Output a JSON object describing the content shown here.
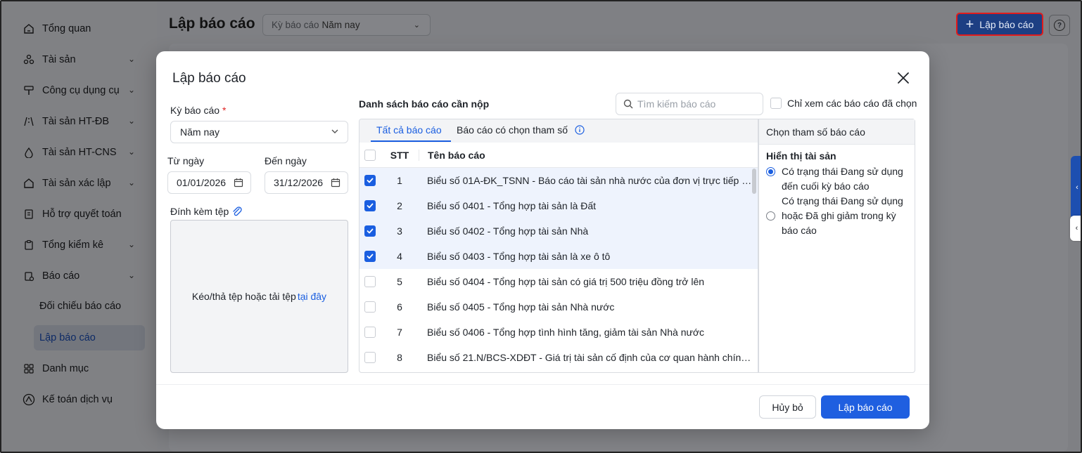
{
  "sidebar": {
    "items": [
      {
        "label": "Tổng quan",
        "icon": "home-icon",
        "has_chevron": false
      },
      {
        "label": "Tài sản",
        "icon": "assets-icon",
        "has_chevron": true
      },
      {
        "label": "Công cụ dụng cụ",
        "icon": "tool-icon",
        "has_chevron": true
      },
      {
        "label": "Tài sản HT-ĐB",
        "icon": "road-icon",
        "has_chevron": true
      },
      {
        "label": "Tài sản HT-CNS",
        "icon": "water-icon",
        "has_chevron": true
      },
      {
        "label": "Tài sản xác lập",
        "icon": "home-outline-icon",
        "has_chevron": true
      },
      {
        "label": "Hỗ trợ quyết toán",
        "icon": "document-icon",
        "has_chevron": false
      },
      {
        "label": "Tổng kiểm kê",
        "icon": "clipboard-icon",
        "has_chevron": true
      },
      {
        "label": "Báo cáo",
        "icon": "report-icon",
        "has_chevron": true
      },
      {
        "label": "Danh mục",
        "icon": "grid-icon",
        "has_chevron": false
      },
      {
        "label": "Kế toán dịch vụ",
        "icon": "service-icon",
        "has_chevron": false
      }
    ],
    "subitems": [
      {
        "label": "Đối chiếu báo cáo",
        "active": false
      },
      {
        "label": "Lập báo cáo",
        "active": true
      }
    ]
  },
  "header": {
    "title": "Lập báo cáo",
    "period_label": "Kỳ báo cáo",
    "period_value": "Năm nay",
    "create_button": "Lập báo cáo"
  },
  "modal": {
    "title": "Lập báo cáo",
    "period_label": "Kỳ báo cáo",
    "required_mark": "*",
    "period_value": "Năm nay",
    "from_label": "Từ ngày",
    "to_label": "Đến ngày",
    "from_date": "01/01/2026",
    "to_date": "31/12/2026",
    "attach_label": "Đính kèm tệp",
    "drop_text": "Kéo/thả tệp hoặc tải tệp",
    "drop_link": "tại đây",
    "list_title": "Danh sách báo cáo cần nộp",
    "search_placeholder": "Tìm kiếm báo cáo",
    "only_selected_label": "Chỉ xem các báo cáo đã chọn",
    "tabs": [
      {
        "label": "Tất cả báo cáo",
        "active": true
      },
      {
        "label": "Báo cáo có chọn tham số",
        "active": false
      }
    ],
    "columns": {
      "stt": "STT",
      "name": "Tên báo cáo"
    },
    "rows": [
      {
        "stt": "1",
        "name": "Biểu số 01A-ĐK_TSNN - Báo cáo tài sản nhà nước của đơn vị trực tiếp sử d...",
        "checked": true
      },
      {
        "stt": "2",
        "name": "Biểu số 0401 - Tổng hợp tài sản là Đất",
        "checked": true
      },
      {
        "stt": "3",
        "name": "Biểu số 0402 - Tổng hợp tài sản Nhà",
        "checked": true
      },
      {
        "stt": "4",
        "name": "Biểu số 0403 - Tổng hợp tài sản là xe ô tô",
        "checked": true
      },
      {
        "stt": "5",
        "name": "Biểu số 0404 - Tổng hợp tài sản có giá trị 500 triệu đồng trở lên",
        "checked": false
      },
      {
        "stt": "6",
        "name": "Biểu số 0405 - Tổng hợp tài sản Nhà nước",
        "checked": false
      },
      {
        "stt": "7",
        "name": "Biểu số 0406 - Tổng hợp tình hình tăng, giảm tài sản Nhà nước",
        "checked": false
      },
      {
        "stt": "8",
        "name": "Biểu số 21.N/BCS-XDĐT - Giá trị tài sản cố định của cơ quan hành chính v...",
        "checked": false
      }
    ],
    "params": {
      "header": "Chọn tham số báo cáo",
      "group_title": "Hiển thị tài sản",
      "options": [
        {
          "label": "Có trạng thái Đang sử dụng đến cuối kỳ báo cáo",
          "selected": true
        },
        {
          "label": "Có trạng thái Đang sử dụng hoặc Đã ghi giảm trong kỳ báo cáo",
          "selected": false
        }
      ]
    },
    "cancel_button": "Hủy bỏ",
    "submit_button": "Lập báo cáo"
  },
  "colors": {
    "primary": "#1f5fe0",
    "overlay": "#7f8084",
    "required": "#e02424",
    "highlight_border": "#e11b1b"
  }
}
